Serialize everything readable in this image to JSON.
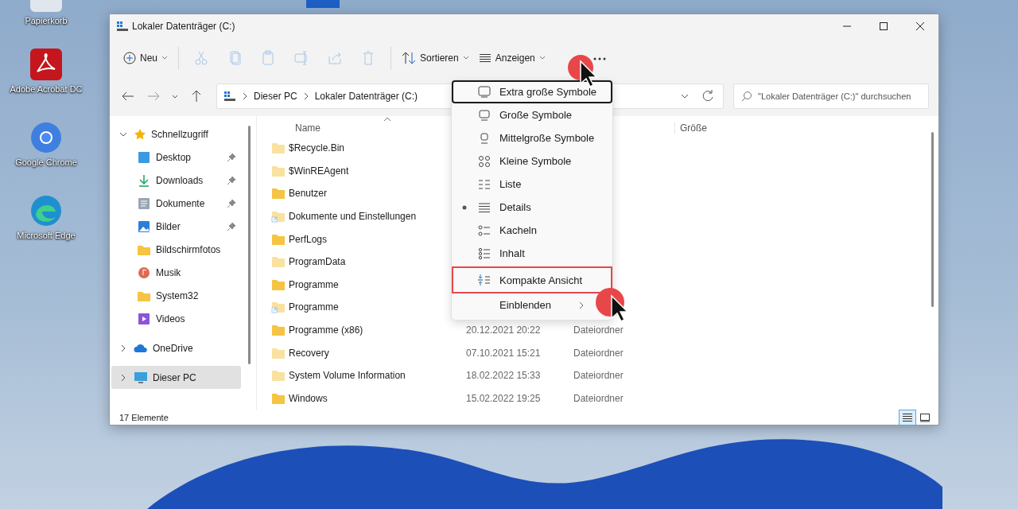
{
  "desktop_icons": [
    {
      "label": "Papierkorb",
      "kind": "bin"
    },
    {
      "label": "Adobe Acrobat DC",
      "kind": "acrobat"
    },
    {
      "label": "Google Chrome",
      "kind": "chrome"
    },
    {
      "label": "Microsoft Edge",
      "kind": "edge"
    }
  ],
  "window": {
    "title": "Lokaler Datenträger (C:)"
  },
  "toolbar": {
    "new": "Neu",
    "sort": "Sortieren",
    "view": "Anzeigen"
  },
  "address": {
    "path": [
      "Dieser PC",
      "Lokaler Datenträger (C:)"
    ]
  },
  "search": {
    "placeholder": "\"Lokaler Datenträger (C:)\" durchsuchen"
  },
  "nav": [
    {
      "label": "Schnellzugriff",
      "kind": "star",
      "expanded": true,
      "selected": false,
      "children": [
        {
          "label": "Desktop",
          "kind": "desktop",
          "pinned": true,
          "selected": false
        },
        {
          "label": "Downloads",
          "kind": "download",
          "pinned": true,
          "selected": false
        },
        {
          "label": "Dokumente",
          "kind": "document",
          "pinned": true,
          "selected": false
        },
        {
          "label": "Bilder",
          "kind": "picture",
          "pinned": true,
          "selected": false
        },
        {
          "label": "Bildschirmfotos",
          "kind": "folder",
          "pinned": false,
          "selected": false
        },
        {
          "label": "Musik",
          "kind": "music",
          "pinned": false,
          "selected": false
        },
        {
          "label": "System32",
          "kind": "folder",
          "pinned": false,
          "selected": false
        },
        {
          "label": "Videos",
          "kind": "video",
          "pinned": false,
          "selected": false
        }
      ]
    },
    {
      "label": "OneDrive",
      "kind": "cloud",
      "expanded": false,
      "selected": false
    },
    {
      "label": "Dieser PC",
      "kind": "pc",
      "expanded": false,
      "selected": true
    }
  ],
  "columns": [
    "Name",
    "Größe"
  ],
  "rows": [
    {
      "name": "$Recycle.Bin",
      "kind": "folder",
      "hidden": true
    },
    {
      "name": "$WinREAgent",
      "kind": "folder",
      "hidden": true
    },
    {
      "name": "Benutzer",
      "kind": "folder",
      "hidden": false
    },
    {
      "name": "Dokumente und Einstellungen",
      "kind": "link",
      "hidden": true
    },
    {
      "name": "PerfLogs",
      "kind": "folder",
      "hidden": false
    },
    {
      "name": "ProgramData",
      "kind": "folder",
      "hidden": true
    },
    {
      "name": "Programme",
      "kind": "folder",
      "hidden": false
    },
    {
      "name": "Programme",
      "kind": "link",
      "hidden": true
    },
    {
      "name": "Programme (x86)",
      "kind": "folder",
      "hidden": false,
      "date": "20.12.2021 20:22",
      "type": "Dateiordner"
    },
    {
      "name": "Recovery",
      "kind": "folder",
      "hidden": true,
      "date": "07.10.2021 15:21",
      "type": "Dateiordner"
    },
    {
      "name": "System Volume Information",
      "kind": "folder",
      "hidden": true,
      "date": "18.02.2022 15:33",
      "type": "Dateiordner"
    },
    {
      "name": "Windows",
      "kind": "folder",
      "hidden": false,
      "date": "15.02.2022 19:25",
      "type": "Dateiordner"
    }
  ],
  "view_menu": [
    {
      "label": "Extra große Symbole",
      "kind": "xl",
      "selected": false,
      "focused": true,
      "highlighted": false
    },
    {
      "label": "Große Symbole",
      "kind": "large",
      "selected": false,
      "focused": false,
      "highlighted": false
    },
    {
      "label": "Mittelgroße Symbole",
      "kind": "medium",
      "selected": false,
      "focused": false,
      "highlighted": false
    },
    {
      "label": "Kleine Symbole",
      "kind": "small",
      "selected": false,
      "focused": false,
      "highlighted": false
    },
    {
      "label": "Liste",
      "kind": "list",
      "selected": false,
      "focused": false,
      "highlighted": false
    },
    {
      "label": "Details",
      "kind": "details",
      "selected": true,
      "focused": false,
      "highlighted": false
    },
    {
      "label": "Kacheln",
      "kind": "tiles",
      "selected": false,
      "focused": false,
      "highlighted": false
    },
    {
      "label": "Inhalt",
      "kind": "content",
      "selected": false,
      "focused": false,
      "highlighted": false
    },
    {
      "label": "Kompakte Ansicht",
      "kind": "compact",
      "selected": false,
      "focused": false,
      "highlighted": true
    },
    {
      "label": "Einblenden",
      "kind": "submenu",
      "selected": false,
      "focused": false,
      "highlighted": false
    }
  ],
  "status_bar": {
    "count": "17 Elemente",
    "views": [
      {
        "kind": "details",
        "selected": true
      },
      {
        "kind": "tiles",
        "selected": false
      }
    ]
  }
}
